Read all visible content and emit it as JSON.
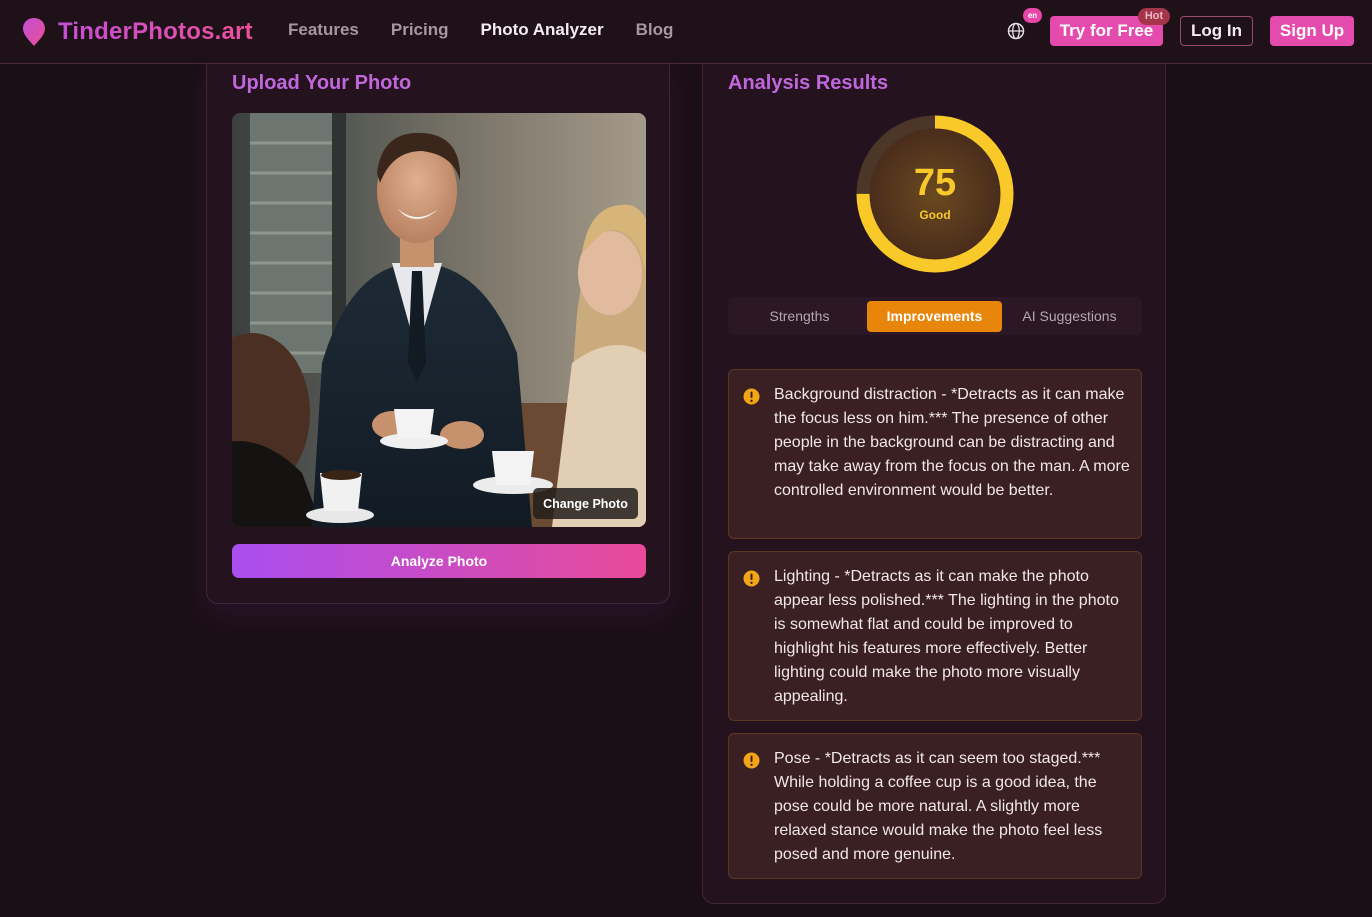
{
  "header": {
    "brand": "TinderPhotos.art",
    "nav": [
      "Features",
      "Pricing",
      "Photo Analyzer",
      "Blog"
    ],
    "active_nav": "Photo Analyzer",
    "language_badge": "en",
    "try_free": "Try for Free",
    "hot_badge": "Hot",
    "login": "Log In",
    "signup": "Sign Up"
  },
  "upload": {
    "title": "Upload Your Photo",
    "change_photo": "Change Photo",
    "analyze_button": "Analyze Photo"
  },
  "results": {
    "title": "Analysis Results",
    "score": 75,
    "score_max": 100,
    "score_label": "Good",
    "tabs": [
      "Strengths",
      "Improvements",
      "AI Suggestions"
    ],
    "active_tab": "Improvements",
    "items": [
      {
        "text": "Background distraction - *Detracts as it can make the focus less on him.*** The presence of other people in the background can be distracting and may take away from the focus on the man. A more controlled environment would be better."
      },
      {
        "text": "Lighting - *Detracts as it can make the photo appear less polished.*** The lighting in the photo is somewhat flat and could be improved to highlight his features more effectively. Better lighting could make the photo more visually appealing."
      },
      {
        "text": "Pose - *Detracts as it can seem too staged.*** While holding a coffee cup is a good idea, the pose could be more natural. A slightly more relaxed stance would make the photo feel less posed and more genuine."
      }
    ]
  },
  "colors": {
    "accent_pink": "#e44bac",
    "title_purple": "#c067dc",
    "score_yellow": "#f8c928",
    "active_tab_orange": "#e8860c",
    "warning_icon": "#f2a516"
  },
  "icons": {
    "logo": "pin-heart-icon",
    "language": "globe-icon",
    "warning": "exclamation-circle-icon"
  }
}
